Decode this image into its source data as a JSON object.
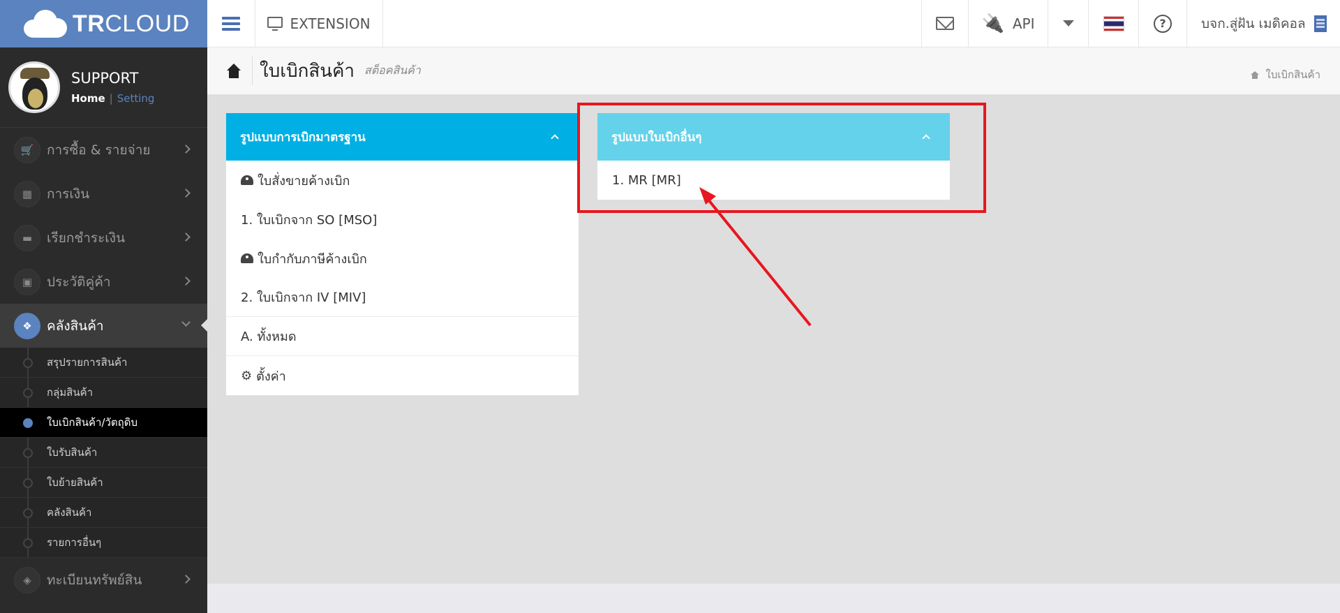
{
  "brand": {
    "name_bold": "TR",
    "name_rest": "CLOUD"
  },
  "topbar": {
    "extension_label": "EXTENSION",
    "api_label": "API",
    "company_name": "บจก.สู่ฝัน เมดิคอล"
  },
  "profile": {
    "name": "SUPPORT",
    "home_link": "Home",
    "separator": "|",
    "setting_link": "Setting"
  },
  "sidebar": {
    "items": [
      {
        "label": "การซื้อ & รายจ่าย",
        "icon": "cart-icon"
      },
      {
        "label": "การเงิน",
        "icon": "calendar-icon"
      },
      {
        "label": "เรียกชำระเงิน",
        "icon": "credit-card-icon"
      },
      {
        "label": "ประวัติคู่ค้า",
        "icon": "address-book-icon"
      },
      {
        "label": "คลังสินค้า",
        "icon": "cubes-icon",
        "active": true
      },
      {
        "label": "ทะเบียนทรัพย์สิน",
        "icon": "diamond-icon"
      }
    ],
    "subitems": [
      {
        "label": "สรุปรายการสินค้า"
      },
      {
        "label": "กลุ่มสินค้า"
      },
      {
        "label": "ใบเบิกสินค้า/วัตถุดิบ",
        "active": true
      },
      {
        "label": "ใบรับสินค้า"
      },
      {
        "label": "ใบย้ายสินค้า"
      },
      {
        "label": "คลังสินค้า"
      },
      {
        "label": "รายการอื่นๆ"
      }
    ]
  },
  "page": {
    "title": "ใบเบิกสินค้า",
    "subtitle": "สต็อคสินค้า",
    "breadcrumb": "ใบเบิกสินค้า"
  },
  "panels": {
    "standard": {
      "title": "รูปแบบการเบิกมาตรฐาน",
      "rows": [
        "ใบสั่งขายค้างเบิก",
        "1. ใบเบิกจาก SO [MSO]",
        "ใบกำกับภาษีค้างเบิก",
        "2. ใบเบิกจาก IV [MIV]",
        "A. ทั้งหมด",
        "ตั้งค่า"
      ]
    },
    "other": {
      "title": "รูปแบบใบเบิกอื่นๆ",
      "rows": [
        "1. MR [MR]"
      ]
    }
  },
  "colors": {
    "brand": "#5b83bf",
    "panel_standard_head": "#00b0e4",
    "panel_other_head": "#64d2ea",
    "annotation": "#e8161f"
  }
}
